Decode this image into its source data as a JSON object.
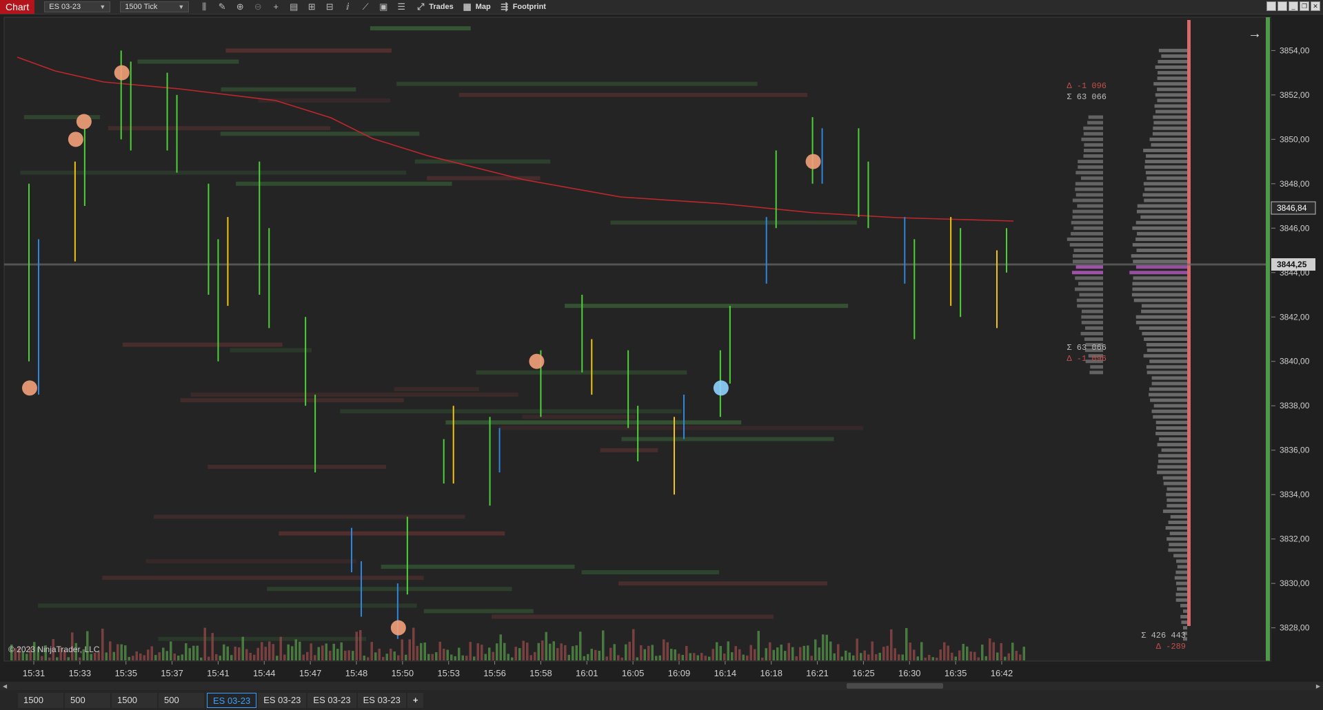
{
  "toolbar": {
    "chart_tab": "Chart",
    "instrument": "ES 03-23",
    "interval": "1500 Tick",
    "trades_label": "Trades",
    "map_label": "Map",
    "footprint_label": "Footprint"
  },
  "copyright": "© 2023 NinjaTrader, LLC",
  "profile_labels": {
    "top_delta": "Δ -1 096",
    "top_sum": "Σ 63 066",
    "bottom_sum": "Σ 63 066",
    "bottom_delta": "Δ -1 096",
    "total_sum": "Σ 426 443",
    "total_delta": "Δ -289"
  },
  "price_axis": {
    "ticks": [
      "3854,00",
      "3852,00",
      "3850,00",
      "3848,00",
      "3846,00",
      "3844,00",
      "3842,00",
      "3840,00",
      "3838,00",
      "3836,00",
      "3834,00",
      "3832,00",
      "3830,00",
      "3828,00"
    ],
    "current_price": "3844,25",
    "sma_price": "3846,84"
  },
  "time_axis": {
    "ticks": [
      "15:31",
      "15:33",
      "15:35",
      "15:37",
      "15:41",
      "15:44",
      "15:47",
      "15:48",
      "15:50",
      "15:53",
      "15:56",
      "15:58",
      "16:01",
      "16:05",
      "16:09",
      "16:14",
      "16:18",
      "16:21",
      "16:25",
      "16:30",
      "16:35",
      "16:42"
    ]
  },
  "bottom_tabs": {
    "tab1": "1500",
    "tab2": "500",
    "tab3": "1500",
    "tab4": "500",
    "tab5": "ES 03-23",
    "tab6": "ES 03-23",
    "tab7": "ES 03-23",
    "tab8": "ES 03-23",
    "add": "+"
  },
  "colors": {
    "up": "#4cd137",
    "down": "#2e86de",
    "doji": "#f1c40f",
    "sma": "#c0272d",
    "bubble_sell": "#f3a07a",
    "bubble_buy": "#8fd3ff"
  },
  "chart_data": {
    "type": "candlestick",
    "y_range": [
      3826.5,
      3855.5
    ],
    "bars": [
      {
        "t": "15:31",
        "h": 3848.0,
        "l": 3840.0,
        "c": "up"
      },
      {
        "t": "15:31",
        "h": 3845.5,
        "l": 3838.5,
        "c": "down"
      },
      {
        "t": "15:33",
        "h": 3849.0,
        "l": 3844.5,
        "c": "doji"
      },
      {
        "t": "15:33",
        "h": 3850.5,
        "l": 3847.0,
        "c": "up"
      },
      {
        "t": "15:35",
        "h": 3854.0,
        "l": 3850.0,
        "c": "up"
      },
      {
        "t": "15:35",
        "h": 3853.5,
        "l": 3849.5,
        "c": "up"
      },
      {
        "t": "15:37",
        "h": 3853.0,
        "l": 3849.5,
        "c": "up"
      },
      {
        "t": "15:37",
        "h": 3852.0,
        "l": 3848.5,
        "c": "up"
      },
      {
        "t": "15:41",
        "h": 3848.0,
        "l": 3843.0,
        "c": "up"
      },
      {
        "t": "15:41",
        "h": 3845.5,
        "l": 3840.0,
        "c": "up"
      },
      {
        "t": "15:41",
        "h": 3846.5,
        "l": 3842.5,
        "c": "doji"
      },
      {
        "t": "15:44",
        "h": 3849.0,
        "l": 3843.0,
        "c": "up"
      },
      {
        "t": "15:44",
        "h": 3846.0,
        "l": 3841.5,
        "c": "up"
      },
      {
        "t": "15:47",
        "h": 3842.0,
        "l": 3838.0,
        "c": "up"
      },
      {
        "t": "15:47",
        "h": 3838.5,
        "l": 3835.0,
        "c": "up"
      },
      {
        "t": "15:48",
        "h": 3832.5,
        "l": 3830.5,
        "c": "down"
      },
      {
        "t": "15:48",
        "h": 3831.0,
        "l": 3828.5,
        "c": "down"
      },
      {
        "t": "15:50",
        "h": 3830.0,
        "l": 3827.5,
        "c": "down"
      },
      {
        "t": "15:50",
        "h": 3833.0,
        "l": 3829.5,
        "c": "up"
      },
      {
        "t": "15:53",
        "h": 3836.5,
        "l": 3834.5,
        "c": "up"
      },
      {
        "t": "15:53",
        "h": 3838.0,
        "l": 3834.5,
        "c": "doji"
      },
      {
        "t": "15:56",
        "h": 3837.5,
        "l": 3833.5,
        "c": "up"
      },
      {
        "t": "15:56",
        "h": 3837.0,
        "l": 3835.0,
        "c": "down"
      },
      {
        "t": "15:58",
        "h": 3840.5,
        "l": 3837.5,
        "c": "up"
      },
      {
        "t": "16:01",
        "h": 3843.0,
        "l": 3839.5,
        "c": "up"
      },
      {
        "t": "16:01",
        "h": 3841.0,
        "l": 3838.5,
        "c": "doji"
      },
      {
        "t": "16:05",
        "h": 3840.5,
        "l": 3837.0,
        "c": "up"
      },
      {
        "t": "16:05",
        "h": 3838.0,
        "l": 3835.5,
        "c": "up"
      },
      {
        "t": "16:09",
        "h": 3837.5,
        "l": 3834.0,
        "c": "doji"
      },
      {
        "t": "16:09",
        "h": 3838.5,
        "l": 3836.5,
        "c": "down"
      },
      {
        "t": "16:14",
        "h": 3840.5,
        "l": 3837.5,
        "c": "up"
      },
      {
        "t": "16:14",
        "h": 3842.5,
        "l": 3839.0,
        "c": "up"
      },
      {
        "t": "16:18",
        "h": 3846.5,
        "l": 3843.5,
        "c": "down"
      },
      {
        "t": "16:18",
        "h": 3849.5,
        "l": 3846.0,
        "c": "up"
      },
      {
        "t": "16:21",
        "h": 3851.0,
        "l": 3848.0,
        "c": "up"
      },
      {
        "t": "16:21",
        "h": 3850.5,
        "l": 3848.0,
        "c": "down"
      },
      {
        "t": "16:25",
        "h": 3850.5,
        "l": 3846.5,
        "c": "up"
      },
      {
        "t": "16:25",
        "h": 3849.0,
        "l": 3846.0,
        "c": "up"
      },
      {
        "t": "16:30",
        "h": 3846.5,
        "l": 3843.5,
        "c": "down"
      },
      {
        "t": "16:30",
        "h": 3845.5,
        "l": 3841.0,
        "c": "up"
      },
      {
        "t": "16:35",
        "h": 3846.5,
        "l": 3842.5,
        "c": "doji"
      },
      {
        "t": "16:35",
        "h": 3846.0,
        "l": 3842.0,
        "c": "up"
      },
      {
        "t": "16:42",
        "h": 3845.0,
        "l": 3841.5,
        "c": "doji"
      },
      {
        "t": "16:42",
        "h": 3846.0,
        "l": 3844.0,
        "c": "up"
      }
    ],
    "bubbles": [
      {
        "t": "15:31",
        "p": 3838.8,
        "kind": "sell"
      },
      {
        "t": "15:33",
        "p": 3850.0,
        "kind": "sell"
      },
      {
        "t": "15:33",
        "p": 3850.8,
        "kind": "sell"
      },
      {
        "t": "15:35",
        "p": 3853.0,
        "kind": "sell"
      },
      {
        "t": "15:50",
        "p": 3828.0,
        "kind": "sell"
      },
      {
        "t": "15:58",
        "p": 3840.0,
        "kind": "sell"
      },
      {
        "t": "16:14",
        "p": 3838.8,
        "kind": "buy"
      },
      {
        "t": "16:21",
        "p": 3849.0,
        "kind": "sell"
      }
    ]
  }
}
